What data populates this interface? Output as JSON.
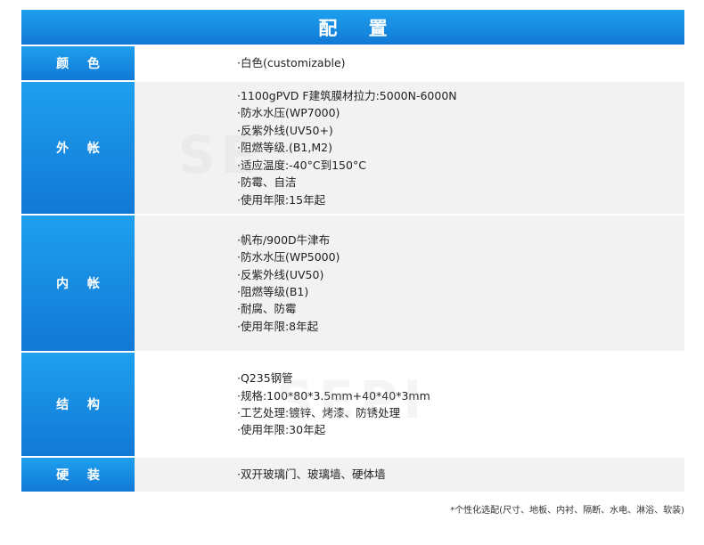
{
  "header": {
    "title": "配 置"
  },
  "rows": [
    {
      "label": "颜 色",
      "items": [
        "·白色(customizable)"
      ]
    },
    {
      "label": "外 帐",
      "items": [
        "·1100gPVD F建筑膜材拉力:5000N-6000N",
        "·防水水压(WP7000)",
        "·反紫外线(UV50+)",
        "·阻燃等级.(B1,M2)",
        "·适应温度:-40°C到150°C",
        "·防霉、自洁",
        "·使用年限:15年起"
      ]
    },
    {
      "label": "内 帐",
      "items": [
        "·帆布/900D牛津布",
        "·防水水压(WP5000)",
        "·反紫外线(UV50)",
        "·阻燃等级(B1)",
        "·耐腐、防霉",
        "·使用年限:8年起"
      ]
    },
    {
      "label": "结 构",
      "items": [
        "·Q235钢管",
        "·规格:100*80*3.5mm+40*40*3mm",
        "·工艺处理:镀锌、烤漆、防锈处理",
        "·使用年限:30年起"
      ]
    },
    {
      "label": "硬 装",
      "items": [
        "·双开玻璃门、玻璃墙、硬体墙"
      ]
    }
  ],
  "footnote": "*个性化选配(尺寸、地板、内衬、隔断、水电、淋浴、软装)",
  "colors": {
    "accent_top": "#1ea0ee",
    "accent_bottom": "#1178d6",
    "row_alt": "#f2f2f2"
  }
}
